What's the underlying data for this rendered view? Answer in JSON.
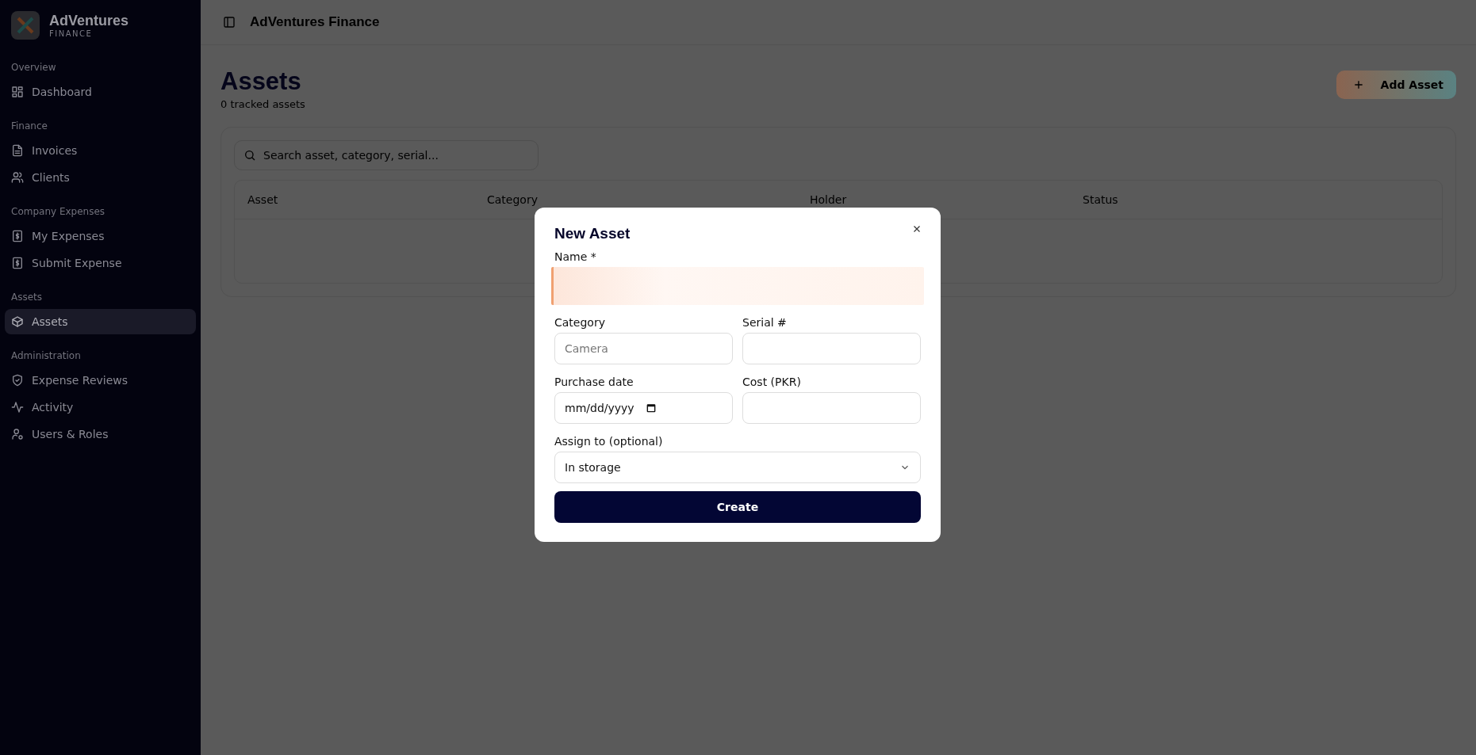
{
  "brand": {
    "name": "AdVentures",
    "tagline": "FINANCE"
  },
  "sidebar": {
    "sections": [
      {
        "title": "Overview",
        "items": [
          {
            "label": "Dashboard",
            "selected": false
          }
        ]
      },
      {
        "title": "Finance",
        "items": [
          {
            "label": "Invoices",
            "selected": false
          },
          {
            "label": "Clients",
            "selected": false
          }
        ]
      },
      {
        "title": "Company Expenses",
        "items": [
          {
            "label": "My Expenses",
            "selected": false
          },
          {
            "label": "Submit Expense",
            "selected": false
          }
        ]
      },
      {
        "title": "Assets",
        "items": [
          {
            "label": "Assets",
            "selected": true
          }
        ]
      },
      {
        "title": "Administration",
        "items": [
          {
            "label": "Expense Reviews",
            "selected": false
          },
          {
            "label": "Activity",
            "selected": false
          },
          {
            "label": "Users & Roles",
            "selected": false
          }
        ]
      }
    ]
  },
  "header": {
    "title": "AdVentures Finance"
  },
  "page": {
    "title": "Assets",
    "subtitle": "0 tracked assets",
    "add_button": "Add Asset",
    "search": {
      "placeholder": "Search asset, category, serial..."
    },
    "table": {
      "columns": [
        "Asset",
        "Category",
        "Holder",
        "Status"
      ]
    }
  },
  "dialog": {
    "title": "New Asset",
    "fields": [
      {
        "kind": "text",
        "label": "Name *",
        "focused": true
      },
      {
        "kind": "text",
        "label": "Category",
        "placeholder": "Camera",
        "focused": false
      },
      {
        "kind": "text",
        "label": "Serial #",
        "focused": false
      },
      {
        "kind": "date",
        "label": "Purchase date",
        "value": "mm/dd/yyyy",
        "focused": false
      },
      {
        "kind": "text",
        "label": "Cost (PKR)",
        "focused": false
      },
      {
        "kind": "select",
        "label": "Assign to (optional)",
        "value": "In storage",
        "focused": false
      }
    ],
    "submit": "Create"
  }
}
